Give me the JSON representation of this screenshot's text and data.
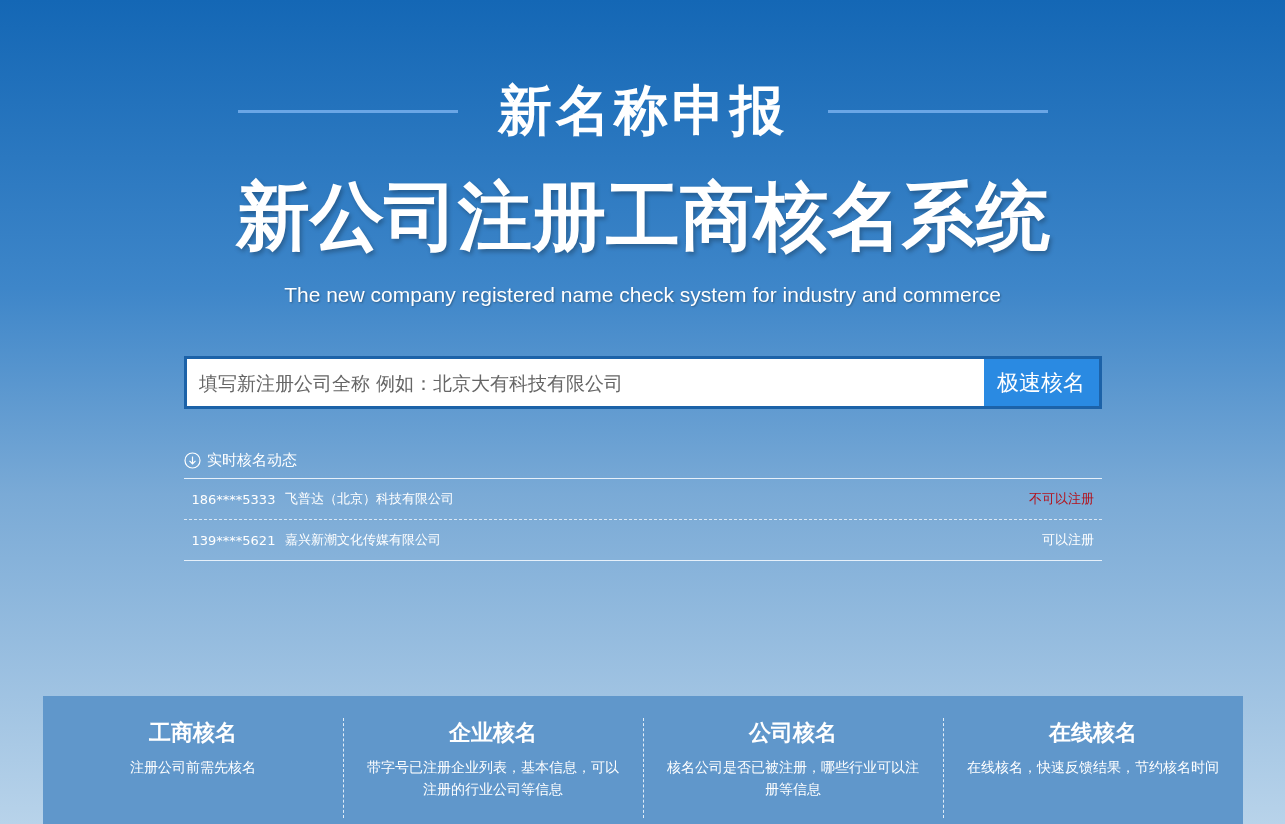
{
  "header": {
    "tag": "新名称申报",
    "title": "新公司注册工商核名系统",
    "subtitle": "The new company registered name check system for industry and commerce"
  },
  "search": {
    "placeholder": "填写新注册公司全称 例如：北京大有科技有限公司",
    "button": "极速核名"
  },
  "feed": {
    "title": "实时核名动态",
    "rows": [
      {
        "phone": "186****5333",
        "company": "飞普达（北京）科技有限公司",
        "status": "不可以注册",
        "registrable": false
      },
      {
        "phone": "139****5621",
        "company": "嘉兴新潮文化传媒有限公司",
        "status": "可以注册",
        "registrable": true
      }
    ]
  },
  "features": [
    {
      "title": "工商核名",
      "desc": "注册公司前需先核名"
    },
    {
      "title": "企业核名",
      "desc": "带字号已注册企业列表，基本信息，可以注册的行业公司等信息"
    },
    {
      "title": "公司核名",
      "desc": "核名公司是否已被注册，哪些行业可以注册等信息"
    },
    {
      "title": "在线核名",
      "desc": "在线核名，快速反馈结果，节约核名时间"
    }
  ]
}
